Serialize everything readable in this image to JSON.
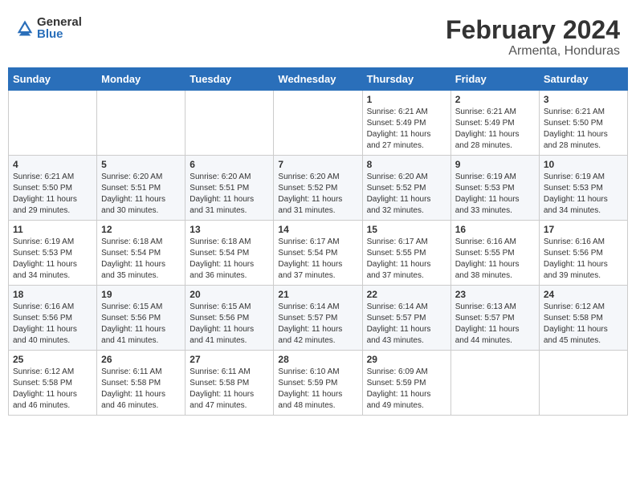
{
  "logo": {
    "general": "General",
    "blue": "Blue"
  },
  "header": {
    "title": "February 2024",
    "subtitle": "Armenta, Honduras"
  },
  "weekdays": [
    "Sunday",
    "Monday",
    "Tuesday",
    "Wednesday",
    "Thursday",
    "Friday",
    "Saturday"
  ],
  "weeks": [
    [
      {
        "day": "",
        "info": ""
      },
      {
        "day": "",
        "info": ""
      },
      {
        "day": "",
        "info": ""
      },
      {
        "day": "",
        "info": ""
      },
      {
        "day": "1",
        "info": "Sunrise: 6:21 AM\nSunset: 5:49 PM\nDaylight: 11 hours\nand 27 minutes."
      },
      {
        "day": "2",
        "info": "Sunrise: 6:21 AM\nSunset: 5:49 PM\nDaylight: 11 hours\nand 28 minutes."
      },
      {
        "day": "3",
        "info": "Sunrise: 6:21 AM\nSunset: 5:50 PM\nDaylight: 11 hours\nand 28 minutes."
      }
    ],
    [
      {
        "day": "4",
        "info": "Sunrise: 6:21 AM\nSunset: 5:50 PM\nDaylight: 11 hours\nand 29 minutes."
      },
      {
        "day": "5",
        "info": "Sunrise: 6:20 AM\nSunset: 5:51 PM\nDaylight: 11 hours\nand 30 minutes."
      },
      {
        "day": "6",
        "info": "Sunrise: 6:20 AM\nSunset: 5:51 PM\nDaylight: 11 hours\nand 31 minutes."
      },
      {
        "day": "7",
        "info": "Sunrise: 6:20 AM\nSunset: 5:52 PM\nDaylight: 11 hours\nand 31 minutes."
      },
      {
        "day": "8",
        "info": "Sunrise: 6:20 AM\nSunset: 5:52 PM\nDaylight: 11 hours\nand 32 minutes."
      },
      {
        "day": "9",
        "info": "Sunrise: 6:19 AM\nSunset: 5:53 PM\nDaylight: 11 hours\nand 33 minutes."
      },
      {
        "day": "10",
        "info": "Sunrise: 6:19 AM\nSunset: 5:53 PM\nDaylight: 11 hours\nand 34 minutes."
      }
    ],
    [
      {
        "day": "11",
        "info": "Sunrise: 6:19 AM\nSunset: 5:53 PM\nDaylight: 11 hours\nand 34 minutes."
      },
      {
        "day": "12",
        "info": "Sunrise: 6:18 AM\nSunset: 5:54 PM\nDaylight: 11 hours\nand 35 minutes."
      },
      {
        "day": "13",
        "info": "Sunrise: 6:18 AM\nSunset: 5:54 PM\nDaylight: 11 hours\nand 36 minutes."
      },
      {
        "day": "14",
        "info": "Sunrise: 6:17 AM\nSunset: 5:54 PM\nDaylight: 11 hours\nand 37 minutes."
      },
      {
        "day": "15",
        "info": "Sunrise: 6:17 AM\nSunset: 5:55 PM\nDaylight: 11 hours\nand 37 minutes."
      },
      {
        "day": "16",
        "info": "Sunrise: 6:16 AM\nSunset: 5:55 PM\nDaylight: 11 hours\nand 38 minutes."
      },
      {
        "day": "17",
        "info": "Sunrise: 6:16 AM\nSunset: 5:56 PM\nDaylight: 11 hours\nand 39 minutes."
      }
    ],
    [
      {
        "day": "18",
        "info": "Sunrise: 6:16 AM\nSunset: 5:56 PM\nDaylight: 11 hours\nand 40 minutes."
      },
      {
        "day": "19",
        "info": "Sunrise: 6:15 AM\nSunset: 5:56 PM\nDaylight: 11 hours\nand 41 minutes."
      },
      {
        "day": "20",
        "info": "Sunrise: 6:15 AM\nSunset: 5:56 PM\nDaylight: 11 hours\nand 41 minutes."
      },
      {
        "day": "21",
        "info": "Sunrise: 6:14 AM\nSunset: 5:57 PM\nDaylight: 11 hours\nand 42 minutes."
      },
      {
        "day": "22",
        "info": "Sunrise: 6:14 AM\nSunset: 5:57 PM\nDaylight: 11 hours\nand 43 minutes."
      },
      {
        "day": "23",
        "info": "Sunrise: 6:13 AM\nSunset: 5:57 PM\nDaylight: 11 hours\nand 44 minutes."
      },
      {
        "day": "24",
        "info": "Sunrise: 6:12 AM\nSunset: 5:58 PM\nDaylight: 11 hours\nand 45 minutes."
      }
    ],
    [
      {
        "day": "25",
        "info": "Sunrise: 6:12 AM\nSunset: 5:58 PM\nDaylight: 11 hours\nand 46 minutes."
      },
      {
        "day": "26",
        "info": "Sunrise: 6:11 AM\nSunset: 5:58 PM\nDaylight: 11 hours\nand 46 minutes."
      },
      {
        "day": "27",
        "info": "Sunrise: 6:11 AM\nSunset: 5:58 PM\nDaylight: 11 hours\nand 47 minutes."
      },
      {
        "day": "28",
        "info": "Sunrise: 6:10 AM\nSunset: 5:59 PM\nDaylight: 11 hours\nand 48 minutes."
      },
      {
        "day": "29",
        "info": "Sunrise: 6:09 AM\nSunset: 5:59 PM\nDaylight: 11 hours\nand 49 minutes."
      },
      {
        "day": "",
        "info": ""
      },
      {
        "day": "",
        "info": ""
      }
    ]
  ]
}
